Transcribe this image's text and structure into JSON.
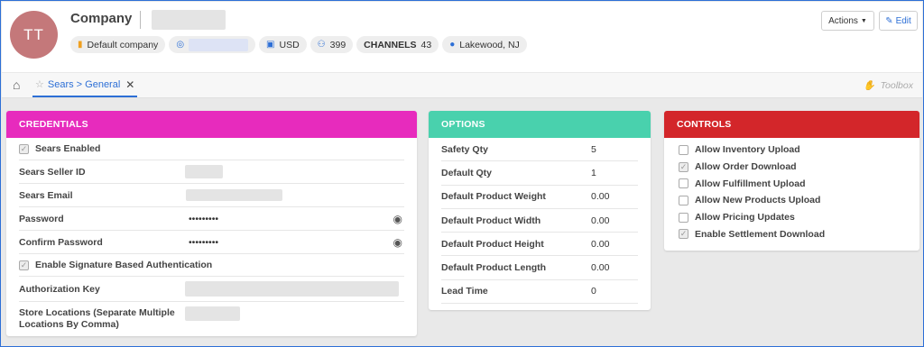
{
  "header": {
    "avatar_initials": "TT",
    "title": "Company",
    "chips": {
      "default_company": "Default company",
      "currency": "USD",
      "users_count": "399",
      "channels_label": "CHANNELS",
      "channels_count": "43",
      "location": "Lakewood, NJ"
    },
    "actions_label": "Actions",
    "edit_label": "Edit"
  },
  "tabbar": {
    "tab_label": "Sears > General",
    "toolbox_label": "Toolbox"
  },
  "credentials": {
    "title": "CREDENTIALS",
    "color": "#e72bbd",
    "sears_enabled": "Sears Enabled",
    "seller_id_label": "Sears Seller ID",
    "email_label": "Sears Email",
    "password_label": "Password",
    "password_value": "•••••••••",
    "confirm_password_label": "Confirm Password",
    "confirm_password_value": "•••••••••",
    "signature_auth": "Enable Signature Based Authentication",
    "auth_key_label": "Authorization Key",
    "store_locations_label": "Store Locations (Separate Multiple Locations By Comma)"
  },
  "options": {
    "title": "OPTIONS",
    "color": "#49d1ad",
    "rows": [
      {
        "label": "Safety Qty",
        "value": "5"
      },
      {
        "label": "Default Qty",
        "value": "1"
      },
      {
        "label": "Default Product Weight",
        "value": "0.00"
      },
      {
        "label": "Default Product Width",
        "value": "0.00"
      },
      {
        "label": "Default Product Height",
        "value": "0.00"
      },
      {
        "label": "Default Product Length",
        "value": "0.00"
      },
      {
        "label": "Lead Time",
        "value": "0"
      }
    ]
  },
  "controls": {
    "title": "CONTROLS",
    "color": "#d3262a",
    "rows": [
      {
        "label": "Allow Inventory Upload",
        "checked": false
      },
      {
        "label": "Allow Order Download",
        "checked": true
      },
      {
        "label": "Allow Fulfillment Upload",
        "checked": false
      },
      {
        "label": "Allow New Products Upload",
        "checked": false
      },
      {
        "label": "Allow Pricing Updates",
        "checked": false
      },
      {
        "label": "Enable Settlement Download",
        "checked": true
      }
    ]
  }
}
